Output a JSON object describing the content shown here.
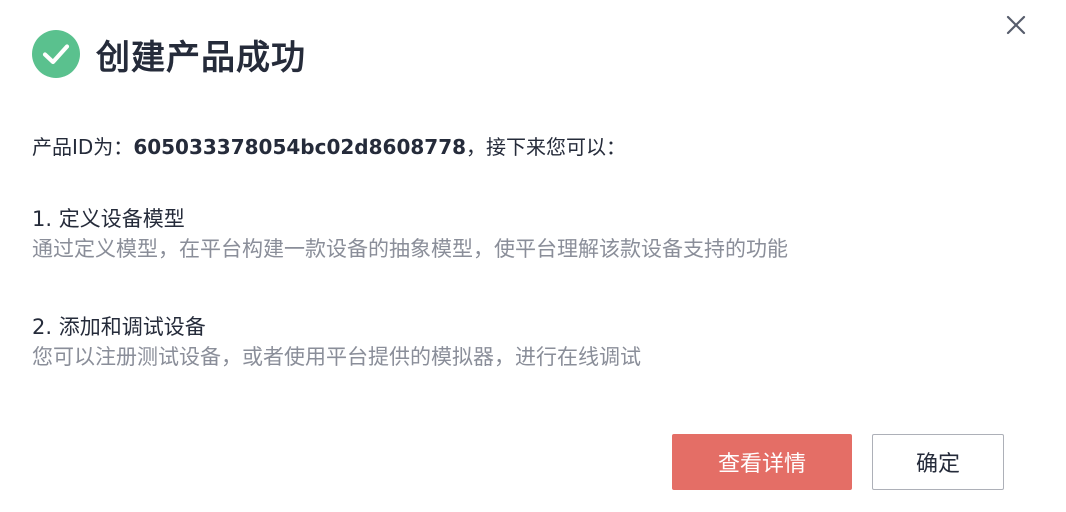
{
  "dialog": {
    "title": "创建产品成功",
    "intro_prefix": "产品ID为：",
    "product_id": "605033378054bc02d8608778",
    "intro_suffix": "，接下来您可以：",
    "steps": [
      {
        "title": "1. 定义设备模型",
        "description": "通过定义模型，在平台构建一款设备的抽象模型，使平台理解该款设备支持的功能"
      },
      {
        "title": "2. 添加和调试设备",
        "description": "您可以注册测试设备，或者使用平台提供的模拟器，进行在线调试"
      }
    ],
    "buttons": {
      "view_details": "查看详情",
      "confirm": "确定"
    }
  },
  "icons": {
    "success": "check-circle-icon",
    "close": "close-icon"
  },
  "colors": {
    "success_green": "#5ac18e",
    "primary_button": "#e46e66",
    "title_text": "#252b3a",
    "secondary_text": "#8a8e99"
  }
}
